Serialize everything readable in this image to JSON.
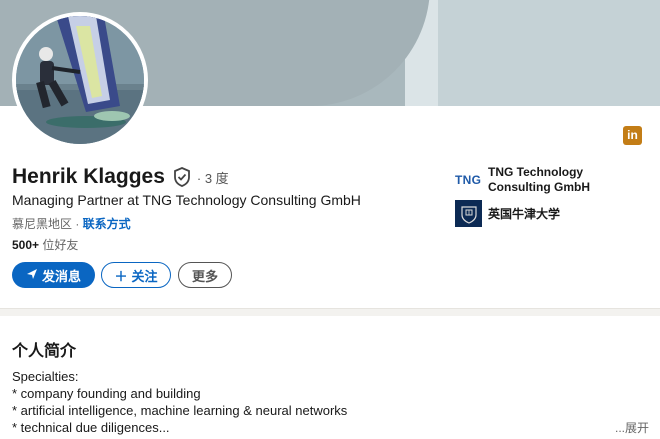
{
  "colors": {
    "accent": "#0a66c2",
    "linkedin_badge": "#c37d16",
    "tng_blue": "#1f5aa8",
    "oxford_navy": "#0c2a54"
  },
  "badge": {
    "label": "in",
    "icon": "linkedin-icon"
  },
  "profile": {
    "name": "Henrik Klagges",
    "verified_icon": "verified-shield-icon",
    "degree": "· 3 度",
    "headline": "Managing Partner at TNG Technology Consulting GmbH",
    "location": "慕尼黑地区 · ",
    "contact_link": "联系方式",
    "connections_count": "500+",
    "connections_label": " 位好友"
  },
  "actions": {
    "message": {
      "label": "发消息",
      "icon": "send-icon"
    },
    "follow": {
      "label": "关注",
      "icon": "plus-icon"
    },
    "more": {
      "label": "更多"
    }
  },
  "experience": {
    "company_logo_text": "TNG",
    "company_name": "TNG Technology Consulting GmbH"
  },
  "education": {
    "school_logo": "oxford-crest-icon",
    "school_name": "英国牛津大学"
  },
  "about": {
    "title": "个人简介",
    "lines": [
      "Specialties:",
      "* company founding and building",
      "* artificial intelligence, machine learning & neural networks",
      "* technical due diligences..."
    ],
    "expand": "...展开"
  }
}
